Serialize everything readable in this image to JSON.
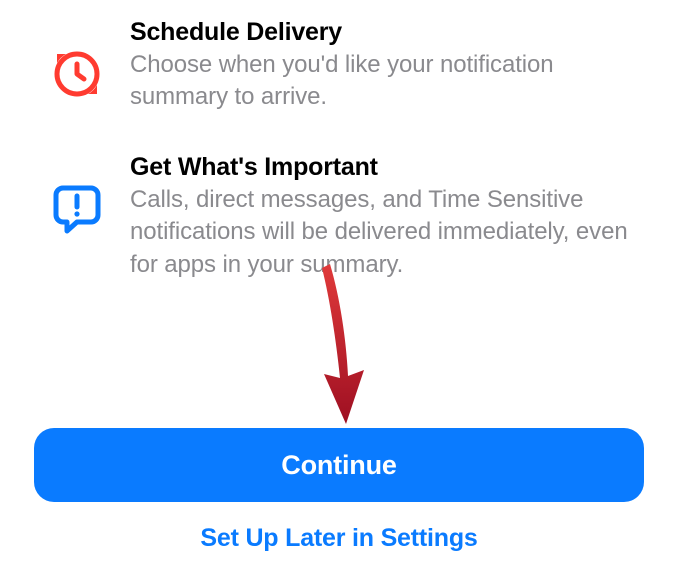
{
  "sections": [
    {
      "title": "Schedule Delivery",
      "description": "Choose when you'd like your notification summary to arrive."
    },
    {
      "title": "Get What's Important",
      "description": "Calls, direct messages, and Time Sensitive notifications will be delivered immediately, even for apps in your summary."
    }
  ],
  "buttons": {
    "primary": "Continue",
    "secondary": "Set Up Later in Settings"
  },
  "annotation": {
    "arrow_color": "#b5152a"
  }
}
